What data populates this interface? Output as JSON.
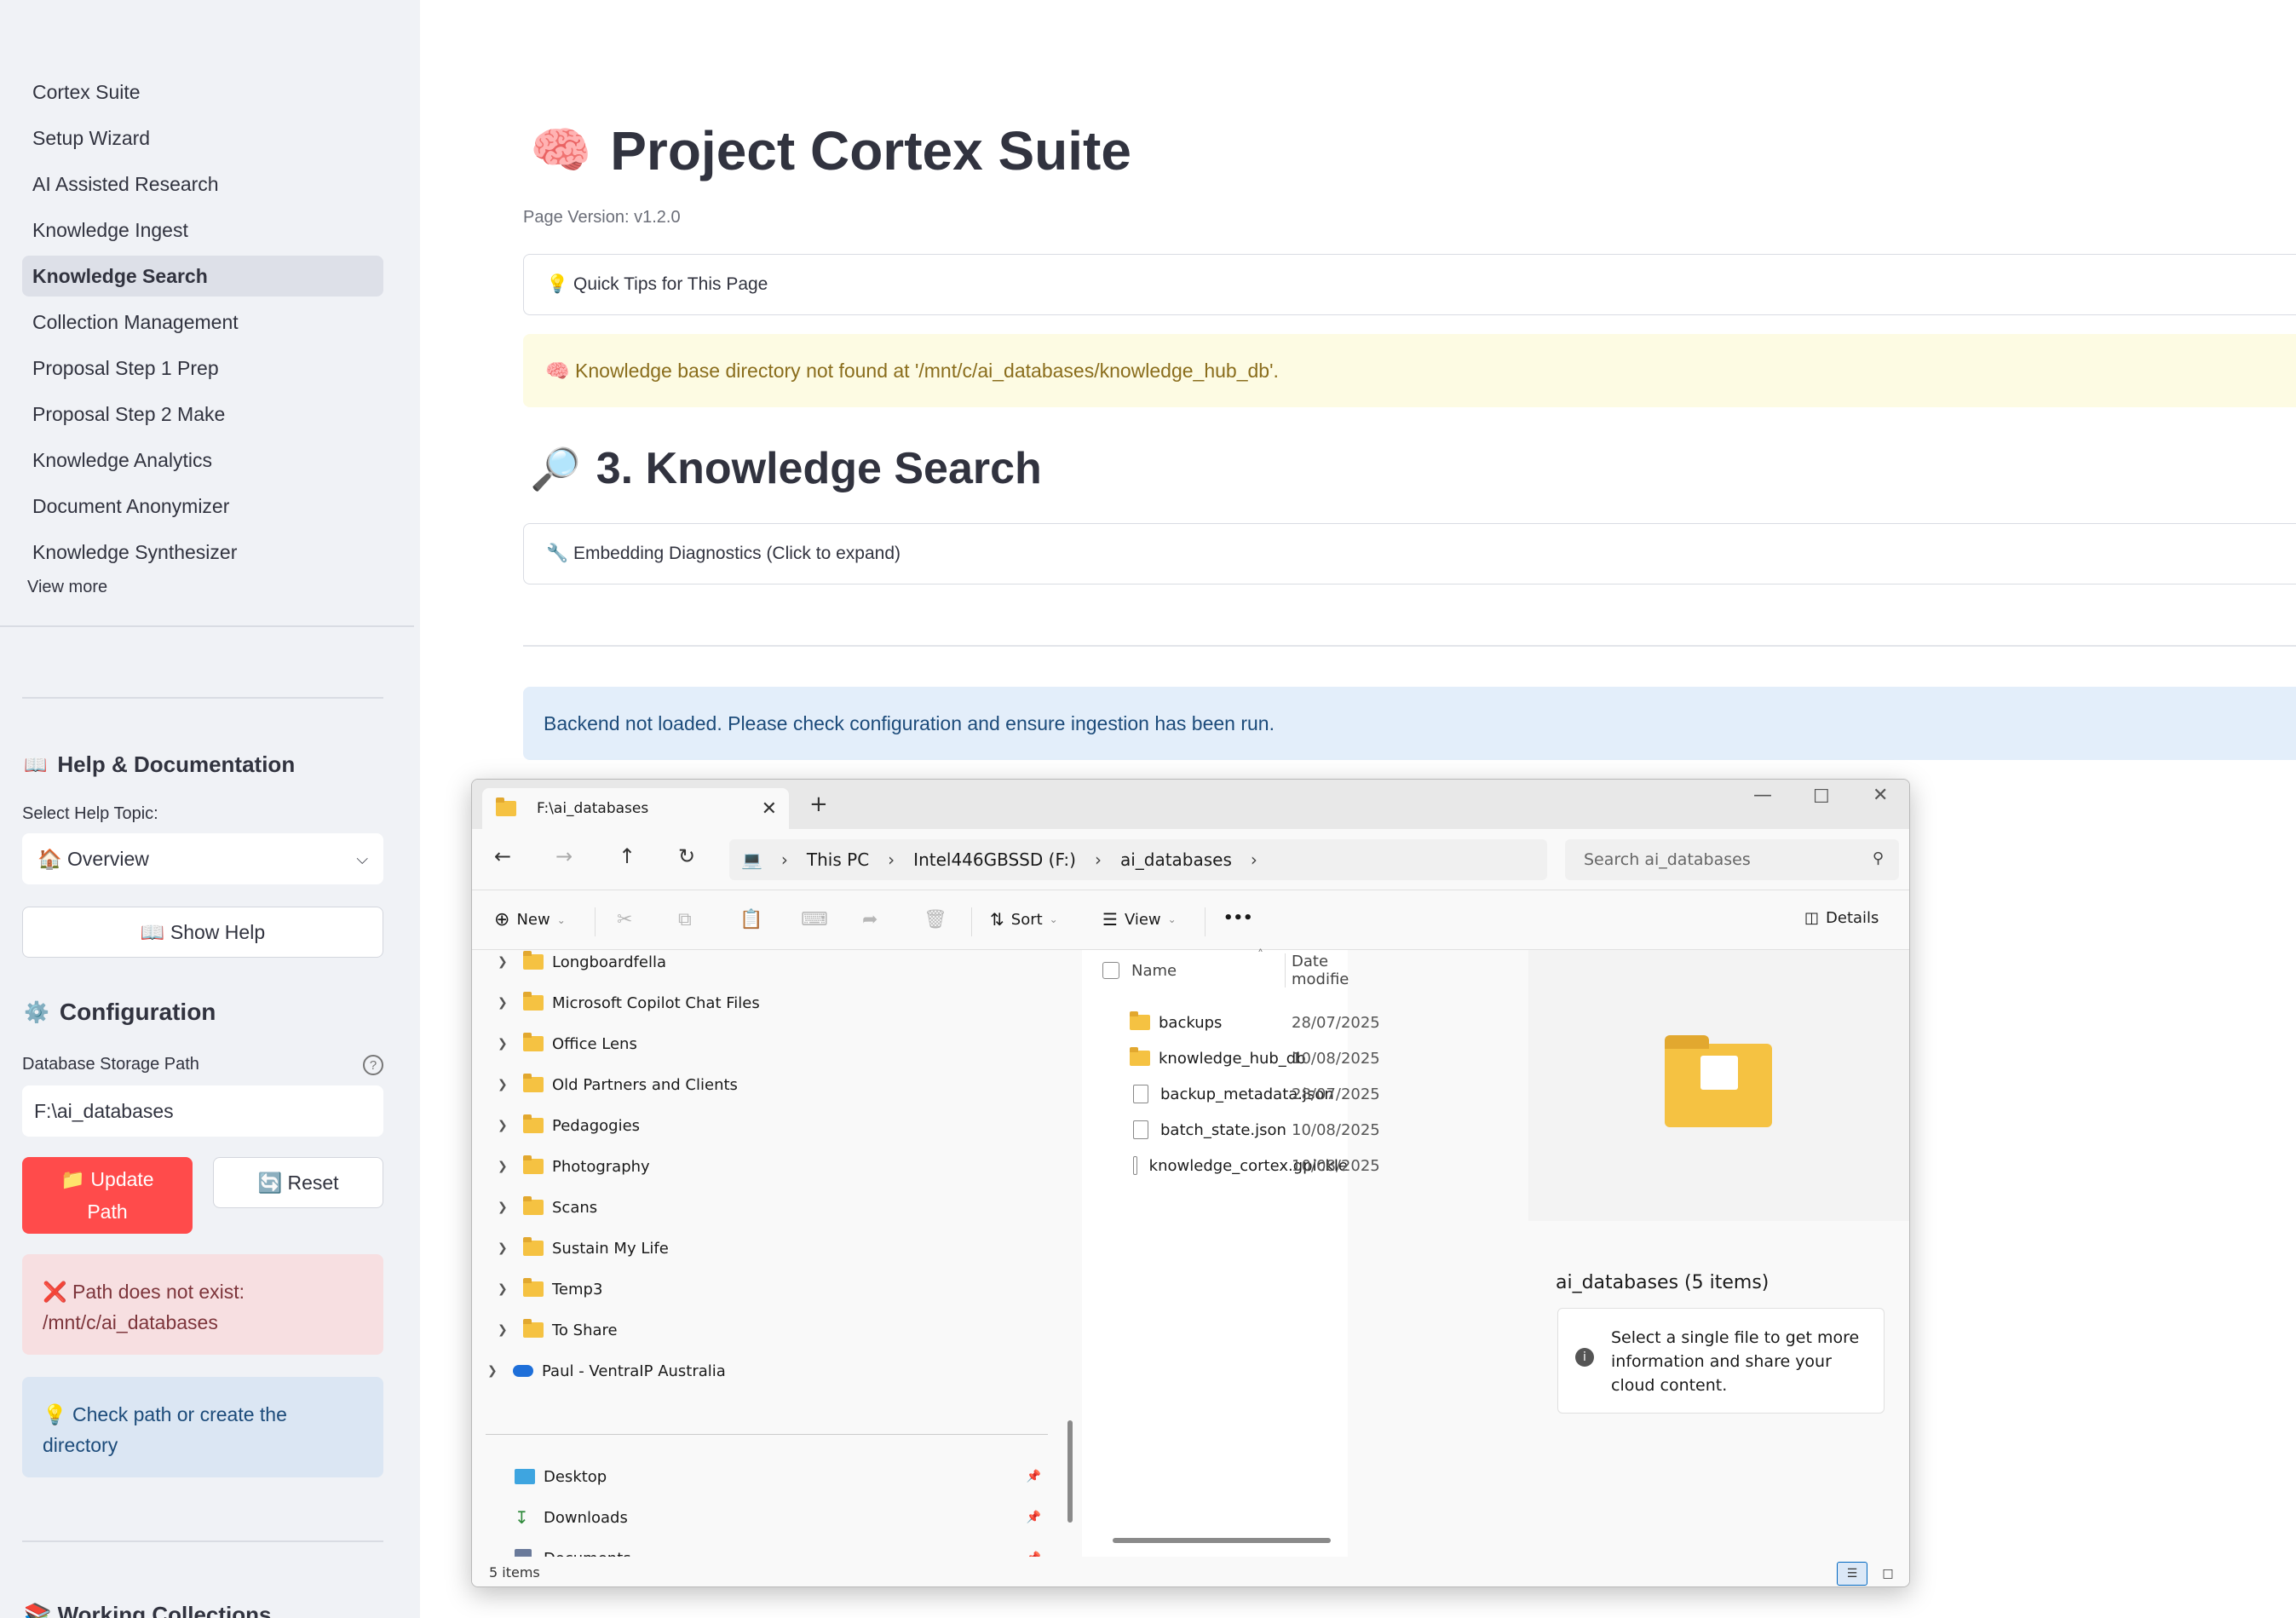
{
  "sidebar": {
    "nav_items": [
      {
        "label": "Cortex Suite"
      },
      {
        "label": "Setup Wizard"
      },
      {
        "label": "AI Assisted Research"
      },
      {
        "label": "Knowledge Ingest"
      },
      {
        "label": "Knowledge Search"
      },
      {
        "label": "Collection Management"
      },
      {
        "label": "Proposal Step 1 Prep"
      },
      {
        "label": "Proposal Step 2 Make"
      },
      {
        "label": "Knowledge Analytics"
      },
      {
        "label": "Document Anonymizer"
      },
      {
        "label": "Knowledge Synthesizer"
      }
    ],
    "active_item": "Knowledge Search",
    "view_more": "View more",
    "help": {
      "heading": "Help & Documentation",
      "heading_icon": "📖",
      "topic_label": "Select Help Topic:",
      "topic_value": "🏠 Overview",
      "show_help": "📖 Show Help"
    },
    "config": {
      "heading": "Configuration",
      "heading_icon": "⚙️",
      "path_label": "Database Storage Path",
      "path_value": "F:\\ai_databases",
      "update_btn": "📁 Update Path",
      "reset_btn": "🔄 Reset",
      "error_text": "❌ Path does not exist: /mnt/c/ai_databases",
      "info_text": "💡 Check path or create the directory"
    },
    "working_collections": "📚 Working Collections"
  },
  "main": {
    "title_icon": "🧠",
    "title": "Project Cortex Suite",
    "page_version": "Page Version: v1.2.0",
    "quick_tips": "💡 Quick Tips for This Page",
    "warning": "🧠 Knowledge base directory not found at '/mnt/c/ai_databases/knowledge_hub_db'.",
    "section_icon": "🔎",
    "section_title": "3. Knowledge Search",
    "diagnostics": "🔧 Embedding Diagnostics (Click to expand)",
    "backend_info": "Backend not loaded. Please check configuration and ensure ingestion has been run."
  },
  "explorer": {
    "tab_title": "F:\\ai_databases",
    "breadcrumbs": [
      "This PC",
      "Intel446GBSSD (F:)",
      "ai_databases"
    ],
    "search_placeholder": "Search ai_databases",
    "commands": {
      "new": "New",
      "sort": "Sort",
      "view": "View",
      "more": "•••",
      "details": "Details"
    },
    "tree": [
      {
        "label": "Longboardfella",
        "type": "folder"
      },
      {
        "label": "Microsoft Copilot Chat Files",
        "type": "folder"
      },
      {
        "label": "Office Lens",
        "type": "folder"
      },
      {
        "label": "Old Partners and Clients",
        "type": "folder"
      },
      {
        "label": "Pedagogies",
        "type": "folder"
      },
      {
        "label": "Photography",
        "type": "folder"
      },
      {
        "label": "Scans",
        "type": "folder"
      },
      {
        "label": "Sustain My Life",
        "type": "folder"
      },
      {
        "label": "Temp3",
        "type": "folder"
      },
      {
        "label": "To Share",
        "type": "folder"
      },
      {
        "label": "Paul - VentraIP Australia",
        "type": "cloud"
      }
    ],
    "quick_access": [
      {
        "label": "Desktop"
      },
      {
        "label": "Downloads"
      },
      {
        "label": "Documents"
      }
    ],
    "columns": {
      "name": "Name",
      "date": "Date modifie"
    },
    "files": [
      {
        "name": "backups",
        "date": "28/07/2025",
        "type": "folder"
      },
      {
        "name": "knowledge_hub_db",
        "date": "10/08/2025",
        "type": "folder"
      },
      {
        "name": "backup_metadata.json",
        "date": "28/07/2025",
        "type": "file"
      },
      {
        "name": "batch_state.json",
        "date": "10/08/2025",
        "type": "file"
      },
      {
        "name": "knowledge_cortex.gpickle",
        "date": "10/08/2025",
        "type": "file"
      }
    ],
    "details_title": "ai_databases (5 items)",
    "details_info": "Select a single file to get more information and share your cloud content.",
    "status": "5 items"
  },
  "colors": {
    "sidebar_bg": "#f0f2f6",
    "primary_red": "#ff4b4b",
    "warning_bg": "#fdfbe3",
    "info_bg": "#e3eefa",
    "error_bg": "#f7dfe1",
    "folder_yellow": "#f5c242"
  }
}
